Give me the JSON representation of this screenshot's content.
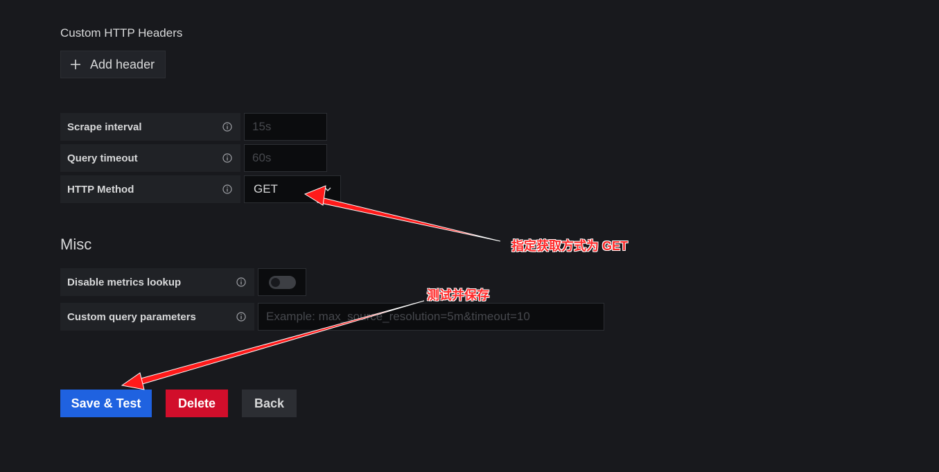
{
  "http_headers": {
    "title": "Custom HTTP Headers",
    "add_button_label": "Add header"
  },
  "settings": {
    "scrape_interval": {
      "label": "Scrape interval",
      "placeholder": "15s"
    },
    "query_timeout": {
      "label": "Query timeout",
      "placeholder": "60s"
    },
    "http_method": {
      "label": "HTTP Method",
      "value": "GET"
    }
  },
  "misc": {
    "title": "Misc",
    "disable_metrics_lookup": {
      "label": "Disable metrics lookup",
      "enabled": false
    },
    "custom_query_parameters": {
      "label": "Custom query parameters",
      "placeholder": "Example: max_source_resolution=5m&timeout=10"
    }
  },
  "actions": {
    "save_label": "Save & Test",
    "delete_label": "Delete",
    "back_label": "Back"
  },
  "annotations": {
    "http_method_note": "指定获取方式为 GET",
    "save_note": "测试并保存",
    "arrow_color": "#ff1a1a"
  },
  "colors": {
    "background": "#18191d",
    "primary": "#1f62e0",
    "destructive": "#d10e2b",
    "secondary": "#2c2e33"
  }
}
